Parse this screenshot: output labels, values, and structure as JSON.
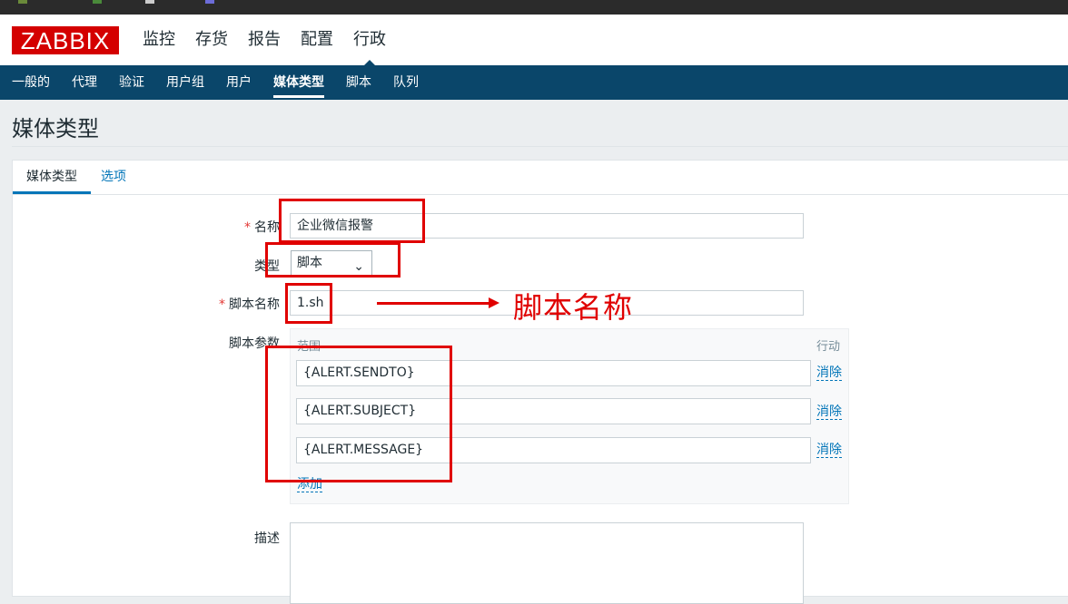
{
  "header": {
    "logo": "ZABBIX",
    "main_nav": [
      "监控",
      "存货",
      "报告",
      "配置",
      "行政"
    ]
  },
  "sub_nav": [
    "一般的",
    "代理",
    "验证",
    "用户组",
    "用户",
    "媒体类型",
    "脚本",
    "队列"
  ],
  "page_title": "媒体类型",
  "tabs": {
    "media_type": "媒体类型",
    "options": "选项"
  },
  "form": {
    "name_label": "名称",
    "name_value": "企业微信报警",
    "type_label": "类型",
    "type_value": "脚本",
    "script_name_label": "脚本名称",
    "script_name_value": "1.sh",
    "script_params_label": "脚本参数",
    "params_col_range": "范围",
    "params_col_action": "行动",
    "params": [
      {
        "value": "{ALERT.SENDTO}",
        "remove": "消除"
      },
      {
        "value": "{ALERT.SUBJECT}",
        "remove": "消除"
      },
      {
        "value": "{ALERT.MESSAGE}",
        "remove": "消除"
      }
    ],
    "add_link": "添加",
    "description_label": "描述"
  },
  "annotation": {
    "text": "脚本名称"
  },
  "colors": {
    "brand_red": "#d40000",
    "nav_blue": "#0a466a",
    "link_blue": "#0275b8",
    "annotation_red": "#e00000"
  }
}
